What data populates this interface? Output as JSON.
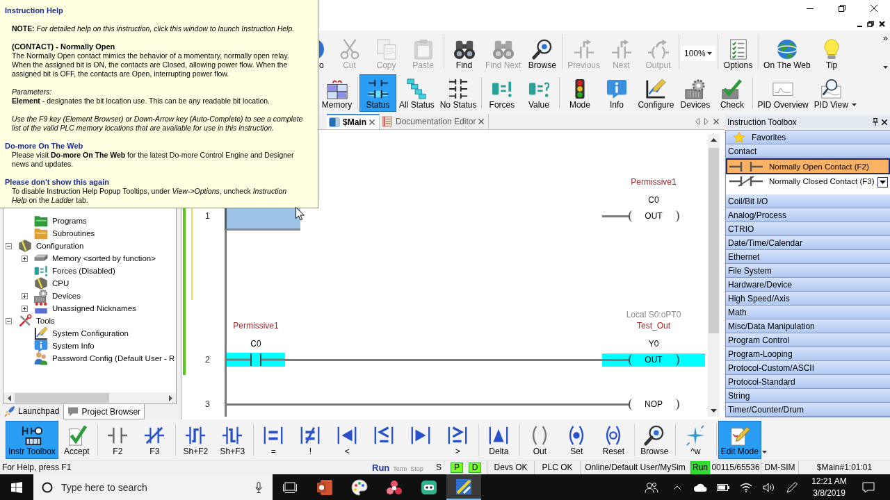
{
  "help_popup": {
    "title": "Instruction Help",
    "note": "**NOTE:** *For detailed help on this instruction, click this window to launch Instruction Help.*",
    "heading": "(CONTACT) - Normally Open",
    "description": "The Normally Open contact mimics the behavior of a momentary, normally open relay. When the assigned bit is ON, the contacts are Closed, allowing power flow. When the assigned bit is OFF, the contacts are Open, interrupting power flow.",
    "parameters_label": "Parameters:",
    "parameter": "**Element** - designates the bit location use. This can be any readable bit location.",
    "hint": "Use the F9 key (Element Browser) or Down-Arrow key (Auto-Complete) to see a complete list of the valid PLC memory locations that are available for use in this instruction.",
    "sections": [
      {
        "title": "Do-more On The Web",
        "text": "Please visit **Do-more On The Web** for the latest Do-more Control Engine and Designer news and updates."
      },
      {
        "title": "Please don't show this again",
        "text": "To disable Instruction Help Popup Tooltips, under *View->Options*, uncheck *Instruction Help* on the *Ladder* tab."
      }
    ]
  },
  "toolbar": {
    "groups": [
      [
        {
          "kind": "undo",
          "label": "o",
          "disabled": false
        },
        {
          "kind": "cut",
          "label": "Cut",
          "disabled": true
        },
        {
          "kind": "copy",
          "label": "Copy",
          "disabled": true
        },
        {
          "kind": "paste",
          "label": "Paste",
          "disabled": true
        }
      ],
      [
        {
          "kind": "find",
          "label": "Find",
          "disabled": false
        },
        {
          "kind": "findnext",
          "label": "Find Next",
          "disabled": true
        },
        {
          "kind": "browse",
          "label": "Browse",
          "disabled": false
        }
      ],
      [
        {
          "kind": "previous",
          "label": "Previous",
          "disabled": true
        },
        {
          "kind": "next",
          "label": "Next",
          "disabled": true
        },
        {
          "kind": "output",
          "label": "Output",
          "disabled": true
        }
      ],
      [
        {
          "kind": "zoom",
          "value": "100%"
        }
      ],
      [
        {
          "kind": "options",
          "label": "Options",
          "disabled": false
        }
      ],
      [
        {
          "kind": "web",
          "label": "On The Web",
          "disabled": false
        },
        {
          "kind": "tip",
          "label": "Tip",
          "disabled": false
        }
      ]
    ],
    "overflow": "»"
  },
  "view_toolbar": {
    "groups": [
      [
        {
          "kind": "memory",
          "label": "Memory"
        }
      ],
      [
        {
          "kind": "status",
          "label": "Status",
          "selected": true
        },
        {
          "kind": "allstatus",
          "label": "All Status",
          "selected": false
        },
        {
          "kind": "nostatus",
          "label": "No Status",
          "selected": false
        }
      ],
      [
        {
          "kind": "forces",
          "label": "Forces"
        },
        {
          "kind": "value",
          "label": "Value"
        }
      ],
      [
        {
          "kind": "mode",
          "label": "Mode"
        },
        {
          "kind": "info",
          "label": "Info"
        },
        {
          "kind": "configure",
          "label": "Configure"
        },
        {
          "kind": "devices",
          "label": "Devices"
        },
        {
          "kind": "check",
          "label": "Check"
        }
      ],
      [
        {
          "kind": "pidoverview",
          "label": "PID Overview"
        },
        {
          "kind": "pidview",
          "label": "PID View",
          "dropdown": true
        }
      ]
    ]
  },
  "project_browser": {
    "tree": [
      {
        "children": [
          {
            "kind": "programs",
            "label": "Programs"
          },
          {
            "kind": "subroutines",
            "label": "Subroutines"
          }
        ]
      },
      {
        "kind": "configuration",
        "label": "Configuration",
        "expanded": true,
        "children": [
          {
            "kind": "memory",
            "label": "Memory <sorted by function>",
            "expanded": false
          },
          {
            "kind": "forces",
            "label": "Forces (Disabled)"
          },
          {
            "kind": "cpu",
            "label": "CPU"
          },
          {
            "kind": "devices",
            "label": "Devices",
            "expanded": false
          },
          {
            "kind": "nicknames",
            "label": "Unassigned Nicknames",
            "expanded": false
          }
        ]
      },
      {
        "kind": "tools",
        "label": "Tools",
        "expanded": true,
        "children": [
          {
            "kind": "sysconfig",
            "label": "System Configuration"
          },
          {
            "kind": "sysinfo",
            "label": "System Info"
          },
          {
            "kind": "password",
            "label": "Password Config (Default User - R"
          }
        ]
      }
    ],
    "tabs": [
      {
        "kind": "launchpad",
        "label": "Launchpad",
        "selected": false
      },
      {
        "kind": "browser",
        "label": "Project Browser",
        "selected": true
      }
    ]
  },
  "editor": {
    "tabs": [
      {
        "kind": "program",
        "label": "$Main",
        "selected": true
      },
      {
        "kind": "document",
        "label": "Documentation Editor",
        "selected": false
      }
    ],
    "rungs": [
      {
        "number": "1",
        "changed": true,
        "pending": true,
        "cursor": true,
        "wired": false,
        "elements": [
          {
            "kind": "coil",
            "nickname": "Permissive1",
            "address": "C0",
            "label": "OUT",
            "powered": false
          }
        ]
      },
      {
        "number": "2",
        "changed": true,
        "pending": false,
        "cursor": false,
        "wired": true,
        "elements": [
          {
            "kind": "contact",
            "nickname": "Permissive1",
            "address": "C0",
            "powered": true
          },
          {
            "kind": "coil",
            "location": "Local S0:oPT0",
            "nickname": "Test_Out",
            "address": "Y0",
            "label": "OUT",
            "powered": true
          }
        ]
      },
      {
        "number": "3",
        "changed": false,
        "pending": false,
        "cursor": false,
        "wired": true,
        "elements": [
          {
            "kind": "coil",
            "label": "NOP",
            "powered": false
          }
        ]
      }
    ]
  },
  "instruction_toolbox": {
    "title": "Instruction Toolbox",
    "favorites": "Favorites",
    "group": "Contact",
    "items": [
      {
        "kind": "open",
        "label": "Normally Open Contact (F2)",
        "selected": true
      },
      {
        "kind": "closed",
        "label": "Normally Closed Contact (F3)",
        "selected": false
      }
    ],
    "categories": [
      "Coil/Bit I/O",
      "Analog/Process",
      "CTRIO",
      "Date/Time/Calendar",
      "Ethernet",
      "File System",
      "Hardware/Device",
      "High Speed/Axis",
      "Math",
      "Misc/Data Manipulation",
      "Program Control",
      "Program-Looping",
      "Protocol-Custom/ASCII",
      "Protocol-Standard",
      "String",
      "Timer/Counter/Drum"
    ]
  },
  "instruction_bar": {
    "groups": [
      [
        {
          "kind": "toolbox",
          "label": "Instr Toolbox",
          "selected": true
        },
        {
          "kind": "accept",
          "label": "Accept"
        }
      ],
      [
        {
          "kind": "open",
          "label": "F2"
        },
        {
          "kind": "closed",
          "label": "F3"
        }
      ],
      [
        {
          "kind": "rising",
          "label": "Sh+F2"
        },
        {
          "kind": "falling",
          "label": "Sh+F3"
        }
      ],
      [
        {
          "kind": "eq",
          "label": "="
        },
        {
          "kind": "ne",
          "label": "!"
        },
        {
          "kind": "lt",
          "label": "<"
        },
        {
          "kind": "le"
        },
        {
          "kind": "gt"
        },
        {
          "kind": "ge",
          "label": ">"
        }
      ],
      [
        {
          "kind": "delta",
          "label": "Delta"
        }
      ],
      [
        {
          "kind": "out",
          "label": "Out"
        },
        {
          "kind": "set",
          "label": "Set"
        },
        {
          "kind": "reset",
          "label": "Reset"
        }
      ],
      [
        {
          "kind": "browse",
          "label": "Browse"
        }
      ],
      [
        {
          "kind": "wizard",
          "label": "^w"
        }
      ],
      [
        {
          "kind": "edit",
          "label": "Edit Mode",
          "selected": true,
          "dropdown": true
        }
      ]
    ]
  },
  "status_bar": {
    "help": "For Help, press F1",
    "modes": [
      {
        "label": "Run",
        "selected": true
      },
      {
        "label": "Term",
        "selected": false
      },
      {
        "label": "Stop",
        "selected": false
      }
    ],
    "flags": [
      {
        "label": "S",
        "on": false
      },
      {
        "label": "P",
        "on": true
      },
      {
        "label": "D",
        "on": true
      }
    ],
    "fields": [
      {
        "text": "Devs OK"
      },
      {
        "text": "PLC OK"
      },
      {
        "text": "Online/Default User/MySim"
      },
      {
        "text": "Run",
        "on": true
      },
      {
        "text": "00115/65536"
      },
      {
        "text": "DM-SIM"
      },
      {
        "text": "$Main#1:01:01"
      }
    ]
  },
  "taskbar": {
    "search": {
      "placeholder": "Type here to search"
    },
    "apps": [
      {
        "kind": "taskview",
        "active": false
      },
      {
        "kind": "slides",
        "active": false
      },
      {
        "kind": "paint",
        "active": false
      },
      {
        "kind": "flower",
        "active": false
      },
      {
        "kind": "robot",
        "active": false
      },
      {
        "kind": "plc",
        "active": true
      }
    ],
    "clock": {
      "time": "12:21 AM",
      "date": "3/8/2019"
    }
  }
}
